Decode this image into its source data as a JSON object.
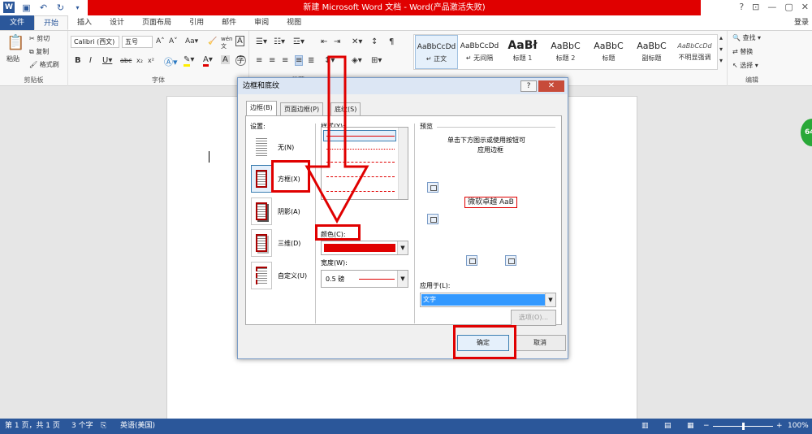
{
  "title_bar": {
    "title": "新建 Microsoft Word 文档 - Word(产品激活失败)",
    "help": "?",
    "minimize": "—",
    "maximize": "▢",
    "close": "✕"
  },
  "tabs": [
    "文件",
    "开始",
    "插入",
    "设计",
    "页面布局",
    "引用",
    "邮件",
    "审阅",
    "视图"
  ],
  "login": "登录",
  "ribbon": {
    "clipboard": {
      "paste": "粘贴",
      "cut": "剪切",
      "copy": "复制",
      "format_painter": "格式刷",
      "label": "剪贴板"
    },
    "font": {
      "font_name": "Calibri (西文)",
      "font_size": "五号",
      "label": "字体"
    },
    "paragraph": {
      "label": "段落"
    },
    "styles": [
      {
        "sample": "AaBbCcDd",
        "name": "↵ 正文"
      },
      {
        "sample": "AaBbCcDd",
        "name": "↵ 无间隔"
      },
      {
        "sample": "AaBł",
        "name": "标题 1"
      },
      {
        "sample": "AaBbC",
        "name": "标题 2"
      },
      {
        "sample": "AaBbC",
        "name": "标题"
      },
      {
        "sample": "AaBbC",
        "name": "副标题"
      },
      {
        "sample": "AaBbCcDd",
        "name": "不明显强调"
      }
    ],
    "editing": {
      "find": "查找",
      "replace": "替换",
      "select": "选择",
      "label": "编辑"
    }
  },
  "dialog": {
    "title": "边框和底纹",
    "help": "?",
    "close": "✕",
    "tabs": [
      "边框(B)",
      "页面边框(P)",
      "底纹(S)"
    ],
    "settings_label": "设置:",
    "settings": [
      "无(N)",
      "方框(X)",
      "阴影(A)",
      "三维(D)",
      "自定义(U)"
    ],
    "style_label": "样式(Y):",
    "color_label": "颜色(C):",
    "width_label": "宽度(W):",
    "width_value": "0.5 磅",
    "preview_label": "预览",
    "preview_hint_1": "单击下方图示或使用按钮可",
    "preview_hint_2": "应用边框",
    "preview_text": "微软卓越 AaB",
    "apply_to_label": "应用于(L):",
    "apply_to_value": "文字",
    "options_button": "选项(O)...",
    "ok_button": "确定",
    "cancel_button": "取消",
    "border_color": "#e00000"
  },
  "statusbar": {
    "page": "第 1 页，共 1 页",
    "words": "3 个字",
    "lang": "英语(美国)",
    "zoom": "100%",
    "zoom_level_percent": 100
  },
  "side_badge": "64",
  "colors": {
    "accent": "#2b579a",
    "annotation": "#e00000",
    "title_red": "#e00000"
  }
}
